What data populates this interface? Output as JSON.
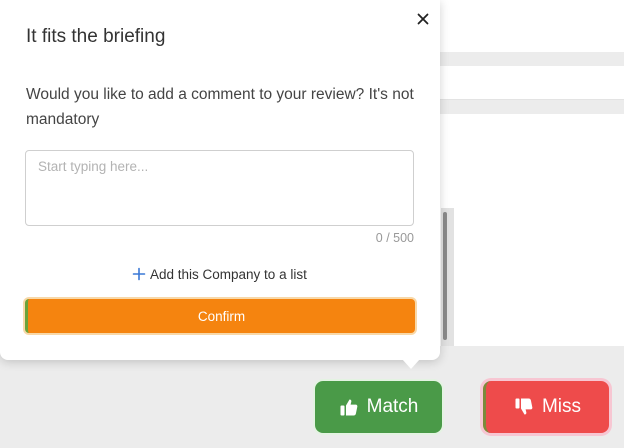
{
  "popover": {
    "title": "It fits the briefing",
    "question": "Would you like to add a comment to your review? It's not mandatory",
    "comment": {
      "value": "",
      "placeholder": "Start typing here...",
      "counter": "0 / 500"
    },
    "add_to_list_label": "Add this Company to a list",
    "confirm_label": "Confirm",
    "close_icon": "close-icon",
    "add_icon": "plus-icon"
  },
  "actions": {
    "match_label": "Match",
    "match_icon": "thumbs-up-icon",
    "miss_label": "Miss",
    "miss_icon": "thumbs-down-icon"
  },
  "colors": {
    "confirm": "#f5840f",
    "match": "#4a9a48",
    "miss": "#ee4b4b",
    "accent_plus": "#3a78d6"
  }
}
